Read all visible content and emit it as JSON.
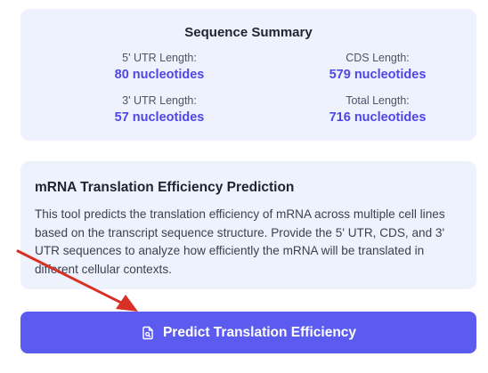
{
  "summary": {
    "title": "Sequence Summary",
    "stats": [
      {
        "label": "5' UTR Length:",
        "value": "80 nucleotides"
      },
      {
        "label": "CDS Length:",
        "value": "579 nucleotides"
      },
      {
        "label": "3' UTR Length:",
        "value": "57 nucleotides"
      },
      {
        "label": "Total Length:",
        "value": "716 nucleotides"
      }
    ]
  },
  "info": {
    "title": "mRNA Translation Efficiency Prediction",
    "description": "This tool predicts the translation efficiency of mRNA across multiple cell lines based on the transcript sequence structure. Provide the 5' UTR, CDS, and 3' UTR sequences to analyze how efficiently the mRNA will be translated in different cellular contexts."
  },
  "predict_button": {
    "label": "Predict Translation Efficiency",
    "icon": "file-search-icon"
  },
  "colors": {
    "accent": "#4f46e5",
    "button": "#5b5bef",
    "card_bg": "#eef2fc",
    "annotation_arrow": "#d93025"
  }
}
